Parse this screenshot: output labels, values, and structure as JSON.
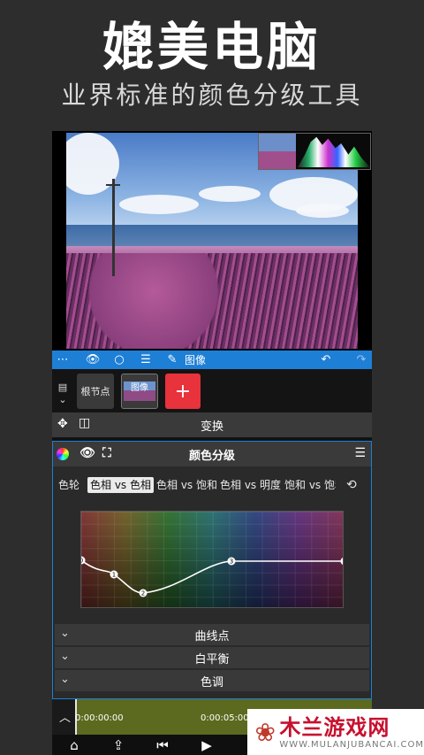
{
  "hero": {
    "title": "媲美电脑",
    "subtitle": "业界标准的颜色分级工具"
  },
  "toolbar": {
    "node_label": "图像"
  },
  "nodes": {
    "root_label": "根节点",
    "image_label": "图像",
    "add_symbol": "+"
  },
  "transform": {
    "label": "变换"
  },
  "panel": {
    "title": "颜色分级"
  },
  "tabs": [
    {
      "label": "色轮",
      "active": false
    },
    {
      "label": "色相 vs 色相",
      "active": true
    },
    {
      "label": "色相 vs 饱和",
      "active": false
    },
    {
      "label": "色相 vs 明度",
      "active": false
    },
    {
      "label": "饱和 vs 饱和",
      "active": false
    }
  ],
  "curve_points": [
    "0",
    "1",
    "2",
    "3",
    "4"
  ],
  "sections": [
    "曲线点",
    "白平衡",
    "色调"
  ],
  "timeline": {
    "start_time": "0:00:00:00",
    "end_time": "0:00:05:00"
  },
  "watermark": {
    "name": "木兰游戏网",
    "url": "WWW.MULANJUBANCAI.COM"
  }
}
